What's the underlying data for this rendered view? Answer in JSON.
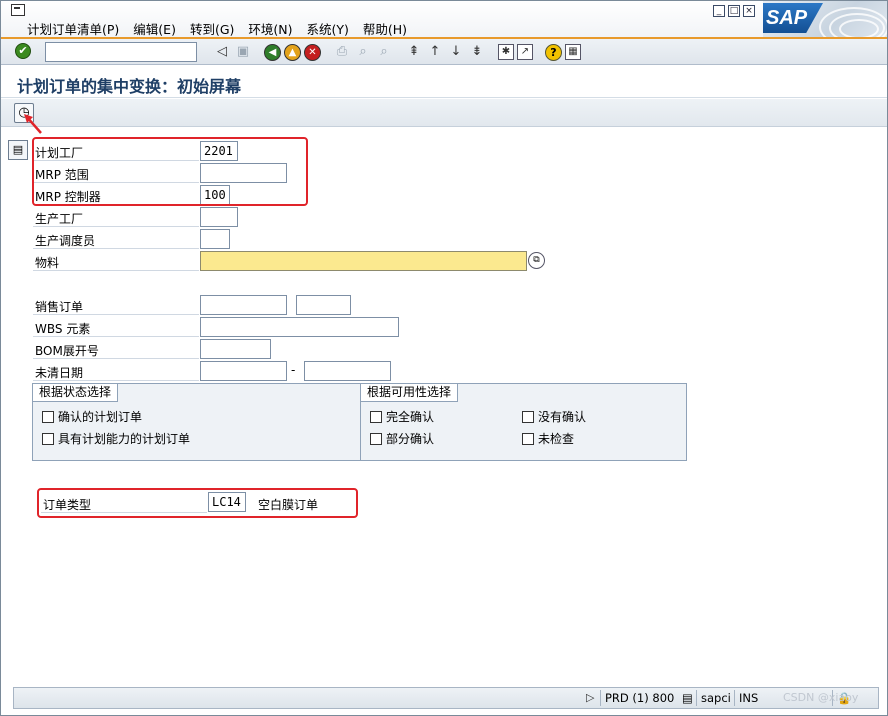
{
  "window": {
    "menus": [
      "计划订单清单(P)",
      "编辑(E)",
      "转到(G)",
      "环境(N)",
      "系统(Y)",
      "帮助(H)"
    ],
    "win_buttons": [
      "_",
      "□",
      "×"
    ],
    "logo_text": "SAP"
  },
  "toolbar": {
    "command_value": ""
  },
  "title": "计划订单的集中变换：初始屏幕",
  "form": {
    "plant": {
      "label": "计划工厂",
      "value": "2201"
    },
    "mrp_area": {
      "label": "MRP 范围",
      "value": ""
    },
    "mrp_controller": {
      "label": "MRP 控制器",
      "value": "100"
    },
    "prod_plant": {
      "label": "生产工厂",
      "value": ""
    },
    "prod_scheduler": {
      "label": "生产调度员",
      "value": ""
    },
    "material": {
      "label": "物料",
      "value": ""
    },
    "sales_order": {
      "label": "销售订单",
      "value": "",
      "item": ""
    },
    "wbs": {
      "label": "WBS 元素",
      "value": ""
    },
    "bom_explosion": {
      "label": "BOM展开号",
      "value": ""
    },
    "open_date": {
      "label": "未清日期",
      "from": "",
      "separator": "-",
      "to": ""
    },
    "order_type": {
      "label": "订单类型",
      "value": "LC14",
      "desc": "空白膜订单"
    }
  },
  "status_group": {
    "title": "根据状态选择",
    "options": [
      "确认的计划订单",
      "具有计划能力的计划订单"
    ]
  },
  "avail_group": {
    "title": "根据可用性选择",
    "options": [
      "完全确认",
      "没有确认",
      "部分确认",
      "未检查"
    ]
  },
  "statusbar": {
    "system": "PRD (1) 800",
    "server": "sapci",
    "mode": "INS"
  },
  "watermark": "CSDN @xiaoy",
  "colors": {
    "highlight": "#e0242a",
    "required": "#fbe98f",
    "title": "#1f3f66"
  }
}
